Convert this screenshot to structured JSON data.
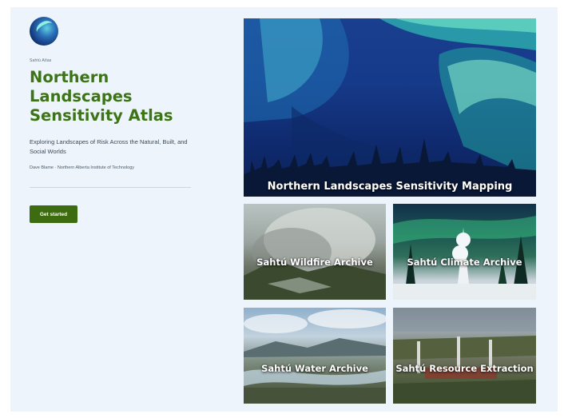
{
  "intro": {
    "kicker": "Sahtú Atlas",
    "title": "Northern Landscapes Sensitivity Atlas",
    "description": "Exploring Landscapes of Risk Across the Natural, Built, and Social Worlds",
    "byline": "Dave Blame · Northern Alberta Institute of Technology",
    "cta_label": "Get started"
  },
  "tiles": {
    "hero": {
      "label": "Northern Landscapes Sensitivity Mapping"
    },
    "wildfire": {
      "label": "Sahtú Wildfire Archive"
    },
    "climate": {
      "label": "Sahtú Climate Archive"
    },
    "water": {
      "label": "Sahtú Water Archive"
    },
    "resource": {
      "label": "Sahtú Resource Extraction"
    }
  },
  "colors": {
    "page_background": "#eef4fb",
    "title_green": "#3d7417",
    "button_green": "#3d6b0f"
  }
}
